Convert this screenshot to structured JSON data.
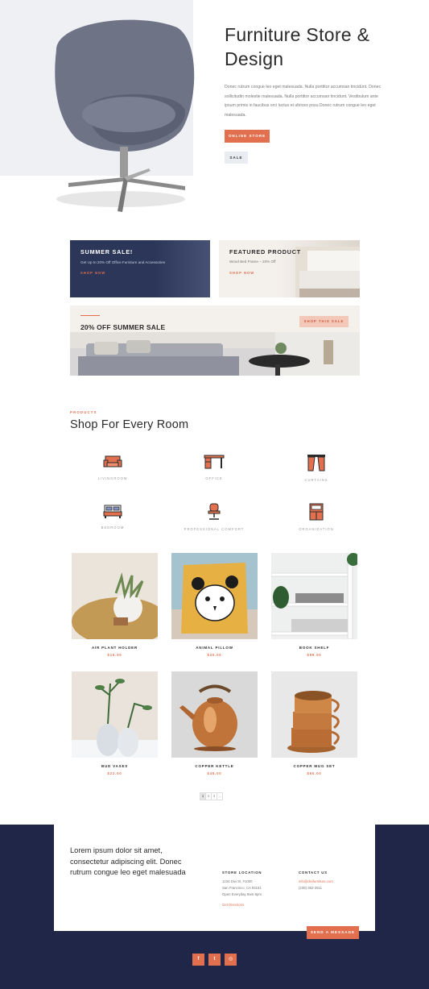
{
  "hero": {
    "title": "Furniture Store & Design",
    "body": "Donec rutrum congue leo eget malesuada. Nulla porttitor accumsan tincidunt. Donec sollicitudin molestie malesuada. Nulla porttitor accumsan tincidunt. Vestibulum ante ipsum primis in faucibus orci luctus et ultrices posu Donec rutrum congue leo eget malesuada.",
    "primary_button": "ONLINE STORE",
    "secondary_button": "SALE"
  },
  "promos": {
    "summer": {
      "title": "SUMMER SALE!",
      "subtitle": "Get Up to 20% Off Office Furniture and Accessories",
      "link": "SHOP NOW"
    },
    "featured": {
      "title": "FEATURED PRODUCT",
      "subtitle": "Wood Bed Frame – 20% Off",
      "link": "SHOP NOW"
    },
    "banner": {
      "title": "20% OFF SUMMER SALE",
      "button": "SHOP THIS SALE"
    }
  },
  "products_section": {
    "eyebrow": "PRODUCTS",
    "title": "Shop For Every Room",
    "rooms": [
      {
        "label": "LIVINGROOM",
        "icon": "sofa-icon"
      },
      {
        "label": "OFFICE",
        "icon": "desk-icon"
      },
      {
        "label": "CURTAINS",
        "icon": "curtains-icon"
      },
      {
        "label": "BEDROOM",
        "icon": "bed-icon"
      },
      {
        "label": "PROFESSIONAL COMFORT",
        "icon": "office-chair-icon"
      },
      {
        "label": "ORGANIZATION",
        "icon": "cabinet-icon"
      }
    ],
    "items": [
      {
        "name": "AIR PLANT HOLDER",
        "price": "$15.00"
      },
      {
        "name": "ANIMAL PILLOW",
        "price": "$20.00"
      },
      {
        "name": "BOOK SHELF",
        "price": "$99.00"
      },
      {
        "name": "BUD VASES",
        "price": "$22.00"
      },
      {
        "name": "COPPER KETTLE",
        "price": "$45.00"
      },
      {
        "name": "COPPER MUG SET",
        "price": "$60.00"
      }
    ],
    "pagination": [
      "1",
      "2",
      "3",
      "→"
    ]
  },
  "footer": {
    "intro": "Lorem ipsum dolor sit amet, consectetur adipiscing elit. Donec rutrum congue leo eget malesuada",
    "store": {
      "title": "STORE LOCATION",
      "line1": "1234 Divi St. #1000",
      "line2": "San Francisco, CA 93151",
      "line3": "Open Everyday 8am-5pm",
      "link": "Get Directions"
    },
    "contact": {
      "title": "CONTACT US",
      "email": "info@divifurniture.com",
      "phone": "(235) 352-2511"
    },
    "send_button": "SEND A MESSAGE",
    "social": [
      "f",
      "t",
      "◎"
    ]
  },
  "colors": {
    "accent": "#e2704f",
    "navy": "#1f2647",
    "card_navy": "#2c3659"
  }
}
